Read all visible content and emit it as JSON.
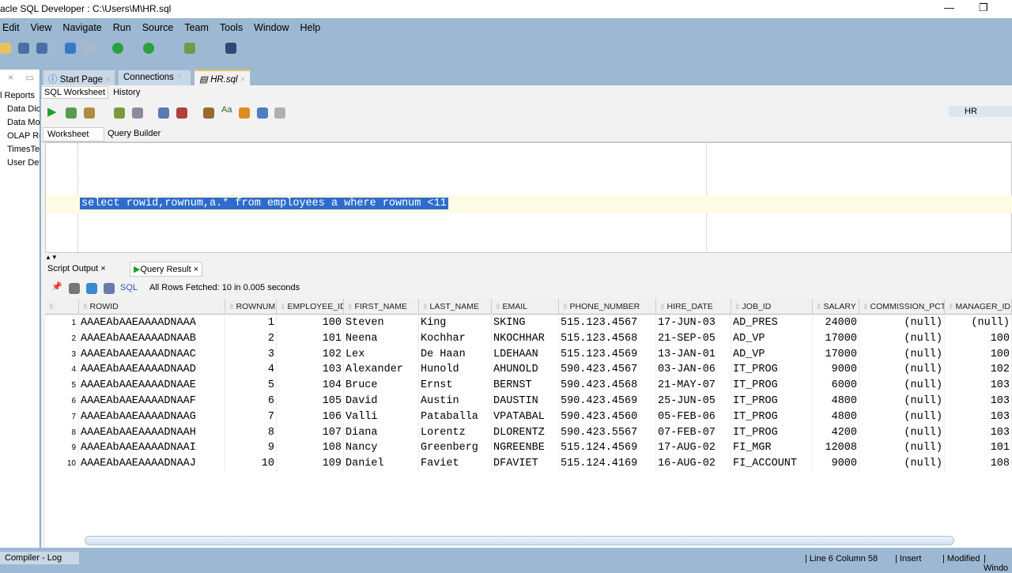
{
  "window": {
    "title": "acle SQL Developer : C:\\Users\\M\\HR.sql",
    "minimize": "—",
    "maximize": "❐"
  },
  "menu": [
    "Edit",
    "View",
    "Navigate",
    "Run",
    "Source",
    "Team",
    "Tools",
    "Window",
    "Help"
  ],
  "left_panel": {
    "items": [
      "l Reports",
      "Data Dic",
      "Data Mo",
      "OLAP Re",
      "TimesTer",
      "User Def"
    ]
  },
  "doc_tabs": [
    {
      "label": "Start Page",
      "icon": "help-icon"
    },
    {
      "label": "Connections"
    },
    {
      "label": "HR.sql",
      "icon": "sql-file-icon",
      "active": true
    }
  ],
  "worksheet": {
    "subtabs": [
      "SQL Worksheet",
      "History"
    ],
    "view_tabs": [
      "Worksheet",
      "Query Builder"
    ],
    "connection": "HR",
    "sql": "select rowid,rownum,a.* from employees a where rownum <11"
  },
  "results": {
    "tabs": [
      "Script Output",
      "Query Result"
    ],
    "sql_label": "SQL",
    "status": "All Rows Fetched: 10 in 0.005 seconds",
    "columns": [
      "ROWID",
      "ROWNUM",
      "EMPLOYEE_ID",
      "FIRST_NAME",
      "LAST_NAME",
      "EMAIL",
      "PHONE_NUMBER",
      "HIRE_DATE",
      "JOB_ID",
      "SALARY",
      "COMMISSION_PCT",
      "MANAGER_ID"
    ],
    "rows": [
      [
        "AAAEAbAAEAAAADNAAA",
        "1",
        "100",
        "Steven",
        "King",
        "SKING",
        "515.123.4567",
        "17-JUN-03",
        "AD_PRES",
        "24000",
        "(null)",
        "(null)"
      ],
      [
        "AAAEAbAAEAAAADNAAB",
        "2",
        "101",
        "Neena",
        "Kochhar",
        "NKOCHHAR",
        "515.123.4568",
        "21-SEP-05",
        "AD_VP",
        "17000",
        "(null)",
        "100"
      ],
      [
        "AAAEAbAAEAAAADNAAC",
        "3",
        "102",
        "Lex",
        "De Haan",
        "LDEHAAN",
        "515.123.4569",
        "13-JAN-01",
        "AD_VP",
        "17000",
        "(null)",
        "100"
      ],
      [
        "AAAEAbAAEAAAADNAAD",
        "4",
        "103",
        "Alexander",
        "Hunold",
        "AHUNOLD",
        "590.423.4567",
        "03-JAN-06",
        "IT_PROG",
        "9000",
        "(null)",
        "102"
      ],
      [
        "AAAEAbAAEAAAADNAAE",
        "5",
        "104",
        "Bruce",
        "Ernst",
        "BERNST",
        "590.423.4568",
        "21-MAY-07",
        "IT_PROG",
        "6000",
        "(null)",
        "103"
      ],
      [
        "AAAEAbAAEAAAADNAAF",
        "6",
        "105",
        "David",
        "Austin",
        "DAUSTIN",
        "590.423.4569",
        "25-JUN-05",
        "IT_PROG",
        "4800",
        "(null)",
        "103"
      ],
      [
        "AAAEAbAAEAAAADNAAG",
        "7",
        "106",
        "Valli",
        "Pataballa",
        "VPATABAL",
        "590.423.4560",
        "05-FEB-06",
        "IT_PROG",
        "4800",
        "(null)",
        "103"
      ],
      [
        "AAAEAbAAEAAAADNAAH",
        "8",
        "107",
        "Diana",
        "Lorentz",
        "DLORENTZ",
        "590.423.5567",
        "07-FEB-07",
        "IT_PROG",
        "4200",
        "(null)",
        "103"
      ],
      [
        "AAAEAbAAEAAAADNAAI",
        "9",
        "108",
        "Nancy",
        "Greenberg",
        "NGREENBE",
        "515.124.4569",
        "17-AUG-02",
        "FI_MGR",
        "12008",
        "(null)",
        "101"
      ],
      [
        "AAAEAbAAEAAAADNAAJ",
        "10",
        "109",
        "Daniel",
        "Faviet",
        "DFAVIET",
        "515.124.4169",
        "16-AUG-02",
        "FI_ACCOUNT",
        "9000",
        "(null)",
        "108"
      ]
    ]
  },
  "statusbar": {
    "log_tab": "Compiler - Log",
    "position": "Line 6 Column 58",
    "mode": "Insert",
    "modified": "Modified",
    "window": "Windo"
  }
}
